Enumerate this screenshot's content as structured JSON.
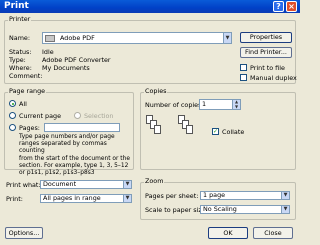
{
  "window": {
    "title": "Print"
  },
  "printer_group": {
    "legend": "Printer",
    "name_label": "Name:",
    "name_value": "Adobe PDF",
    "status_label": "Status:",
    "status_value": "Idle",
    "type_label": "Type:",
    "type_value": "Adobe PDF Converter",
    "where_label": "Where:",
    "where_value": "My Documents",
    "comment_label": "Comment:",
    "properties_label": "Properties",
    "find_printer_label": "Find Printer...",
    "print_to_file_label": "Print to file",
    "manual_duplex_label": "Manual duplex"
  },
  "page_range": {
    "legend": "Page range",
    "all_label": "All",
    "current_page_label": "Current page",
    "selection_label": "Selection",
    "pages_label": "Pages:",
    "hint_lines": [
      "Type page numbers and/or page",
      "ranges separated by commas counting",
      "from the start of the document or the",
      "section. For example, type 1, 3, 5–12",
      "or p1s1, p1s2, p1s3–p8s3"
    ]
  },
  "copies": {
    "legend": "Copies",
    "number_label": "Number of copies:",
    "number_value": "1",
    "collate_label": "Collate",
    "collate_checked": true
  },
  "print_what": {
    "label": "Print what:",
    "value": "Document"
  },
  "print_which": {
    "label": "Print:",
    "value": "All pages in range"
  },
  "zoom": {
    "legend": "Zoom",
    "pages_per_sheet_label": "Pages per sheet:",
    "pages_per_sheet_value": "1 page",
    "scale_label": "Scale to paper size:",
    "scale_value": "No Scaling"
  },
  "footer": {
    "options_label": "Options...",
    "ok_label": "OK",
    "close_label": "Close"
  }
}
